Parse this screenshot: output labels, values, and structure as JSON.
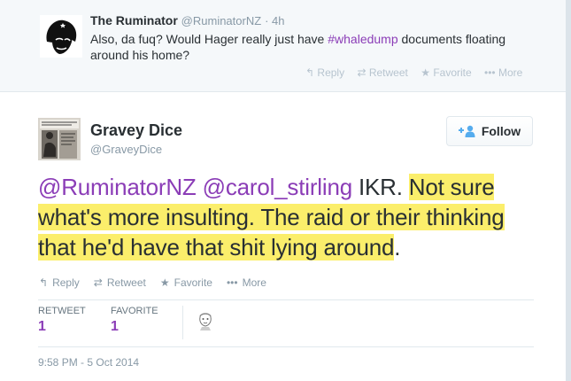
{
  "parent_tweet": {
    "name": "The Ruminator",
    "handle": "@RuminatorNZ",
    "time": "· 4h",
    "text_before": "Also, da fuq? Would Hager really just have ",
    "hashtag": "#whaledump",
    "text_after": " documents floating around his home?",
    "actions": {
      "reply": "Reply",
      "retweet": "Retweet",
      "favorite": "Favorite",
      "more": "More"
    }
  },
  "tweet": {
    "name": "Gravey Dice",
    "handle": "@GraveyDice",
    "follow_label": "Follow",
    "mention_1": "@RuminatorNZ",
    "mention_2": "@carol_stirling",
    "text_plain": " IKR. ",
    "text_highlighted": "Not sure what's more insulting.  The raid or their thinking that he'd have that shit lying around",
    "text_end": ".",
    "actions": {
      "reply": "Reply",
      "retweet": "Retweet",
      "favorite": "Favorite",
      "more": "More"
    },
    "stats": {
      "retweets_label": "RETWEET",
      "retweets_value": "1",
      "favorites_label": "FAVORITE",
      "favorites_value": "1"
    },
    "timestamp": "9:58 PM - 5 Oct 2014"
  },
  "colors": {
    "accent": "#8b3db7",
    "highlight": "#fbee6b",
    "muted": "#8899a6"
  }
}
